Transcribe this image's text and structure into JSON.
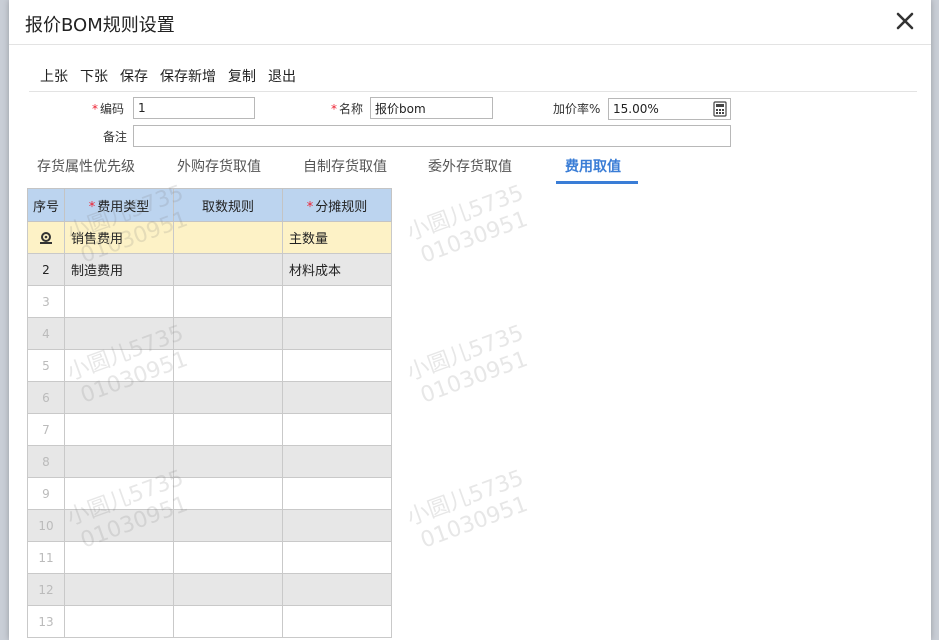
{
  "dialog": {
    "title": "报价BOM规则设置"
  },
  "toolbar": {
    "prev": "上张",
    "next": "下张",
    "save": "保存",
    "save_new": "保存新增",
    "copy": "复制",
    "exit": "退出"
  },
  "form": {
    "code": {
      "label": "编码",
      "value": "1"
    },
    "name": {
      "label": "名称",
      "value": "报价bom"
    },
    "markup": {
      "label": "加价率%",
      "value": "15.00%"
    },
    "note": {
      "label": "备注",
      "value": ""
    }
  },
  "tabs": [
    {
      "label": "存货属性优先级"
    },
    {
      "label": "外购存货取值"
    },
    {
      "label": "自制存货取值"
    },
    {
      "label": "委外存货取值"
    },
    {
      "label": "费用取值"
    }
  ],
  "active_tab": "费用取值",
  "grid": {
    "headers": {
      "seq": "序号",
      "fee_type": "费用类型",
      "fetch_rule": "取数规则",
      "alloc_rule": "分摊规则"
    },
    "rows": [
      {
        "seq": "",
        "fee_type": "销售费用",
        "fetch_rule": "",
        "alloc_rule": "主数量"
      },
      {
        "seq": "2",
        "fee_type": "制造费用",
        "fetch_rule": "",
        "alloc_rule": "材料成本"
      },
      {
        "seq": "3",
        "fee_type": "",
        "fetch_rule": "",
        "alloc_rule": ""
      },
      {
        "seq": "4",
        "fee_type": "",
        "fetch_rule": "",
        "alloc_rule": ""
      },
      {
        "seq": "5",
        "fee_type": "",
        "fetch_rule": "",
        "alloc_rule": ""
      },
      {
        "seq": "6",
        "fee_type": "",
        "fetch_rule": "",
        "alloc_rule": ""
      },
      {
        "seq": "7",
        "fee_type": "",
        "fetch_rule": "",
        "alloc_rule": ""
      },
      {
        "seq": "8",
        "fee_type": "",
        "fetch_rule": "",
        "alloc_rule": ""
      },
      {
        "seq": "9",
        "fee_type": "",
        "fetch_rule": "",
        "alloc_rule": ""
      },
      {
        "seq": "10",
        "fee_type": "",
        "fetch_rule": "",
        "alloc_rule": ""
      },
      {
        "seq": "11",
        "fee_type": "",
        "fetch_rule": "",
        "alloc_rule": ""
      },
      {
        "seq": "12",
        "fee_type": "",
        "fetch_rule": "",
        "alloc_rule": ""
      },
      {
        "seq": "13",
        "fee_type": "",
        "fetch_rule": "",
        "alloc_rule": ""
      }
    ]
  },
  "watermark": {
    "line1": "小圆儿5735",
    "line2": "01030951"
  },
  "icons": {
    "close": "close-icon",
    "calculator": "calculator-icon",
    "row_settings": "gear-icon"
  },
  "colors": {
    "accent": "#3a7dd6",
    "header_bg": "#bcd4ef",
    "selected_row": "#fdf2c6",
    "required": "#e23333"
  }
}
